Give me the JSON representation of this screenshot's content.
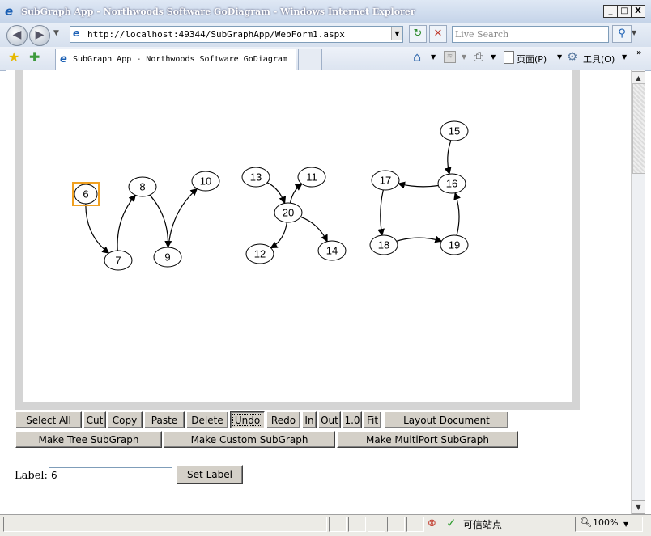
{
  "window": {
    "title": "SubGraph App - Northwoods Software GoDiagram - Windows Internet Explorer",
    "minimize": "_",
    "maximize": "□",
    "close": "X"
  },
  "address_bar": {
    "url": "http://localhost:49344/SubGraphApp/WebForm1.aspx",
    "search_placeholder": "Live Search"
  },
  "tab": {
    "title": "SubGraph App - Northwoods Software GoDiagram"
  },
  "command_bar": {
    "page_label": "页面(P)",
    "tools_label": "工具(O)"
  },
  "diagram": {
    "selected_node": "6",
    "nodes": [
      {
        "id": "6",
        "label": "6"
      },
      {
        "id": "7",
        "label": "7"
      },
      {
        "id": "8",
        "label": "8"
      },
      {
        "id": "9",
        "label": "9"
      },
      {
        "id": "10",
        "label": "10"
      },
      {
        "id": "11",
        "label": "11"
      },
      {
        "id": "12",
        "label": "12"
      },
      {
        "id": "13",
        "label": "13"
      },
      {
        "id": "14",
        "label": "14"
      },
      {
        "id": "15",
        "label": "15"
      },
      {
        "id": "16",
        "label": "16"
      },
      {
        "id": "17",
        "label": "17"
      },
      {
        "id": "18",
        "label": "18"
      },
      {
        "id": "19",
        "label": "19"
      },
      {
        "id": "20",
        "label": "20"
      }
    ],
    "links": [
      [
        "6",
        "7"
      ],
      [
        "7",
        "8"
      ],
      [
        "8",
        "9"
      ],
      [
        "9",
        "10"
      ],
      [
        "13",
        "20"
      ],
      [
        "20",
        "11"
      ],
      [
        "20",
        "12"
      ],
      [
        "20",
        "14"
      ],
      [
        "15",
        "16"
      ],
      [
        "16",
        "17"
      ],
      [
        "17",
        "18"
      ],
      [
        "18",
        "19"
      ],
      [
        "19",
        "16"
      ]
    ]
  },
  "toolbar_row1": {
    "select_all": "Select All",
    "cut": "Cut",
    "copy": "Copy",
    "paste": "Paste",
    "delete": "Delete",
    "undo": "Undo",
    "redo": "Redo",
    "zoom_in": "In",
    "zoom_out": "Out",
    "zoom_reset": "1.0",
    "fit": "Fit",
    "layout": "Layout Document"
  },
  "toolbar_row2": {
    "make_tree": "Make Tree SubGraph",
    "make_custom": "Make Custom SubGraph",
    "make_multiport": "Make MultiPort SubGraph"
  },
  "label_form": {
    "label": "Label:",
    "value": "6",
    "set_button": "Set Label"
  },
  "status_bar": {
    "trusted": "可信站点",
    "zoom": "100%"
  }
}
